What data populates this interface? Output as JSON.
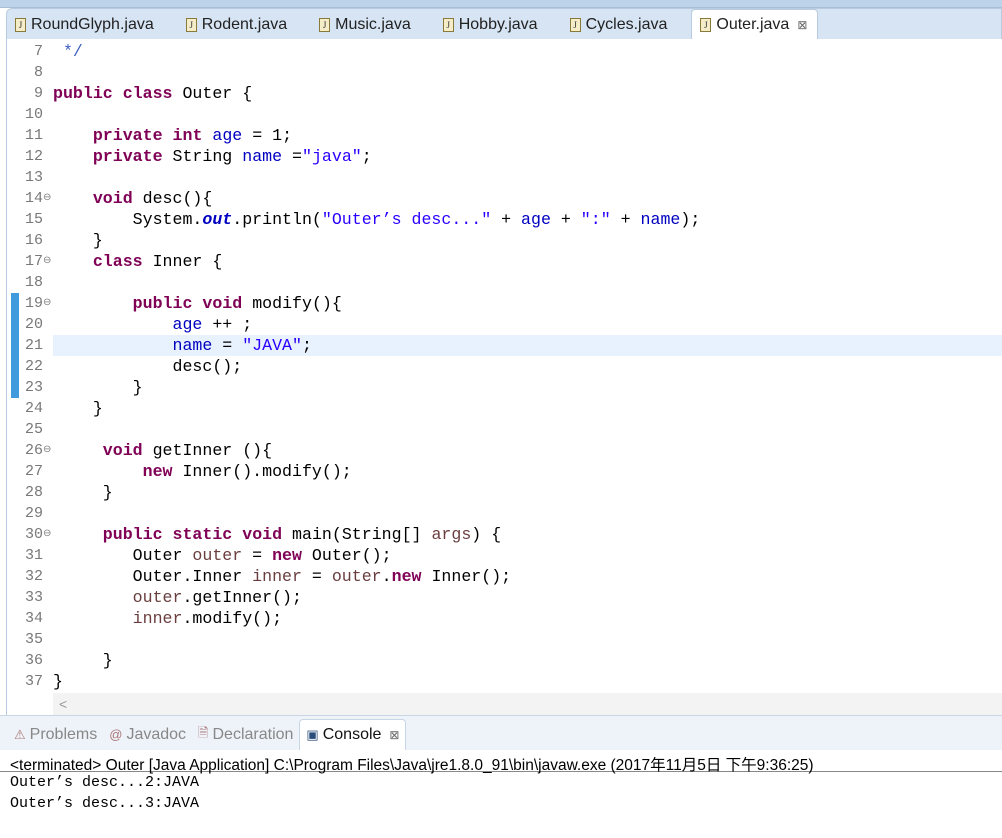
{
  "editor_tabs": [
    {
      "label": "RoundGlyph.java",
      "active": false
    },
    {
      "label": "Rodent.java",
      "active": false
    },
    {
      "label": "Music.java",
      "active": false
    },
    {
      "label": "Hobby.java",
      "active": false
    },
    {
      "label": "Cycles.java",
      "active": false
    },
    {
      "label": "Outer.java",
      "active": true,
      "close": "⊠"
    }
  ],
  "code": {
    "highlight_line": 21,
    "changed_lines": [
      19,
      20,
      21,
      22,
      23
    ],
    "fold_lines": [
      14,
      17,
      19,
      26,
      30
    ],
    "lines": [
      {
        "n": "7",
        "t": [
          [
            "cm",
            " */"
          ]
        ]
      },
      {
        "n": "8",
        "t": []
      },
      {
        "n": "9",
        "t": [
          [
            "kw",
            "public"
          ],
          [
            "pl",
            " "
          ],
          [
            "kw",
            "class"
          ],
          [
            "pl",
            " Outer {"
          ]
        ]
      },
      {
        "n": "10",
        "t": []
      },
      {
        "n": "11",
        "t": [
          [
            "pl",
            "    "
          ],
          [
            "kw",
            "private"
          ],
          [
            "pl",
            " "
          ],
          [
            "kw",
            "int"
          ],
          [
            "pl",
            " "
          ],
          [
            "fd",
            "age"
          ],
          [
            "pl",
            " = 1;"
          ]
        ]
      },
      {
        "n": "12",
        "t": [
          [
            "pl",
            "    "
          ],
          [
            "kw",
            "private"
          ],
          [
            "pl",
            " String "
          ],
          [
            "fd",
            "name"
          ],
          [
            "pl",
            " ="
          ],
          [
            "st",
            "\"java\""
          ],
          [
            "pl",
            ";"
          ]
        ]
      },
      {
        "n": "13",
        "t": []
      },
      {
        "n": "14",
        "t": [
          [
            "pl",
            "    "
          ],
          [
            "kw",
            "void"
          ],
          [
            "pl",
            " desc(){"
          ]
        ]
      },
      {
        "n": "15",
        "t": [
          [
            "pl",
            "        System."
          ],
          [
            "sf",
            "out"
          ],
          [
            "pl",
            ".println("
          ],
          [
            "st",
            "\"Outer’s desc...\""
          ],
          [
            "pl",
            " + "
          ],
          [
            "fd",
            "age"
          ],
          [
            "pl",
            " + "
          ],
          [
            "st",
            "\":\""
          ],
          [
            "pl",
            " + "
          ],
          [
            "fd",
            "name"
          ],
          [
            "pl",
            ");"
          ]
        ]
      },
      {
        "n": "16",
        "t": [
          [
            "pl",
            "    }"
          ]
        ]
      },
      {
        "n": "17",
        "t": [
          [
            "pl",
            "    "
          ],
          [
            "kw",
            "class"
          ],
          [
            "pl",
            " Inner {"
          ]
        ]
      },
      {
        "n": "18",
        "t": []
      },
      {
        "n": "19",
        "t": [
          [
            "pl",
            "        "
          ],
          [
            "kw",
            "public"
          ],
          [
            "pl",
            " "
          ],
          [
            "kw",
            "void"
          ],
          [
            "pl",
            " modify(){"
          ]
        ]
      },
      {
        "n": "20",
        "t": [
          [
            "pl",
            "            "
          ],
          [
            "fd",
            "age"
          ],
          [
            "pl",
            " ++ ;"
          ]
        ]
      },
      {
        "n": "21",
        "t": [
          [
            "pl",
            "            "
          ],
          [
            "fd",
            "name"
          ],
          [
            "pl",
            " = "
          ],
          [
            "st",
            "\"JAVA\""
          ],
          [
            "pl",
            ";"
          ]
        ]
      },
      {
        "n": "22",
        "t": [
          [
            "pl",
            "            desc();"
          ]
        ]
      },
      {
        "n": "23",
        "t": [
          [
            "pl",
            "        }"
          ]
        ]
      },
      {
        "n": "24",
        "t": [
          [
            "pl",
            "    }"
          ]
        ]
      },
      {
        "n": "25",
        "t": []
      },
      {
        "n": "26",
        "t": [
          [
            "pl",
            "     "
          ],
          [
            "kw",
            "void"
          ],
          [
            "pl",
            " getInner (){"
          ]
        ]
      },
      {
        "n": "27",
        "t": [
          [
            "pl",
            "         "
          ],
          [
            "kw",
            "new"
          ],
          [
            "pl",
            " Inner().modify();"
          ]
        ]
      },
      {
        "n": "28",
        "t": [
          [
            "pl",
            "     }"
          ]
        ]
      },
      {
        "n": "29",
        "t": []
      },
      {
        "n": "30",
        "t": [
          [
            "pl",
            "     "
          ],
          [
            "kw",
            "public"
          ],
          [
            "pl",
            " "
          ],
          [
            "kw",
            "static"
          ],
          [
            "pl",
            " "
          ],
          [
            "kw",
            "void"
          ],
          [
            "pl",
            " main(String[] "
          ],
          [
            "lv",
            "args"
          ],
          [
            "pl",
            ") {"
          ]
        ]
      },
      {
        "n": "31",
        "t": [
          [
            "pl",
            "        Outer "
          ],
          [
            "lv",
            "outer"
          ],
          [
            "pl",
            " = "
          ],
          [
            "kw",
            "new"
          ],
          [
            "pl",
            " Outer();"
          ]
        ]
      },
      {
        "n": "32",
        "t": [
          [
            "pl",
            "        Outer.Inner "
          ],
          [
            "lv",
            "inner"
          ],
          [
            "pl",
            " = "
          ],
          [
            "lv",
            "outer"
          ],
          [
            "pl",
            "."
          ],
          [
            "kw",
            "new"
          ],
          [
            "pl",
            " Inner();"
          ]
        ]
      },
      {
        "n": "33",
        "t": [
          [
            "pl",
            "        "
          ],
          [
            "lv",
            "outer"
          ],
          [
            "pl",
            ".getInner();"
          ]
        ]
      },
      {
        "n": "34",
        "t": [
          [
            "pl",
            "        "
          ],
          [
            "lv",
            "inner"
          ],
          [
            "pl",
            ".modify();"
          ]
        ]
      },
      {
        "n": "35",
        "t": []
      },
      {
        "n": "36",
        "t": [
          [
            "pl",
            "     }"
          ]
        ]
      },
      {
        "n": "37",
        "t": [
          [
            "pl",
            "}"
          ]
        ]
      }
    ]
  },
  "scroll_left": "<",
  "bottom_tabs": [
    {
      "label": "Problems",
      "icon": "problems-icon",
      "glyph": "⚠",
      "active": false
    },
    {
      "label": "Javadoc",
      "icon": "at-icon",
      "glyph": "@",
      "active": false
    },
    {
      "label": "Declaration",
      "icon": "declaration-icon",
      "glyph": "🗎",
      "active": false
    },
    {
      "label": "Console",
      "icon": "console-icon",
      "glyph": "▣",
      "active": true,
      "close": "⊠"
    }
  ],
  "console": {
    "header": "<terminated> Outer [Java Application] C:\\Program Files\\Java\\jre1.8.0_91\\bin\\javaw.exe (2017年11月5日 下午9:36:25)",
    "output": [
      "Outer’s desc...2:JAVA",
      "Outer’s desc...3:JAVA"
    ]
  }
}
